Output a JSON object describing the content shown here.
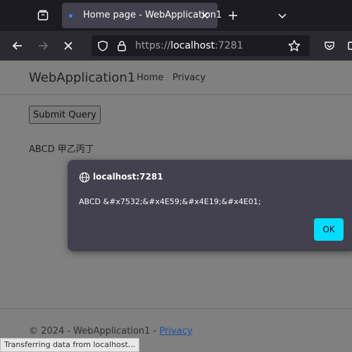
{
  "browser": {
    "tab": {
      "title": "Home page - WebApplication1"
    },
    "url": {
      "prefix": "https://",
      "host": "localhost",
      "port": ":7281"
    },
    "icons": [
      "tab-overview-icon",
      "new-tab-icon",
      "list-tabs-icon",
      "back-icon",
      "forward-icon",
      "stop-icon",
      "shield-icon",
      "lock-icon",
      "bookmark-star-icon",
      "pocket-icon",
      "extensions-icon"
    ],
    "status": "Transferring data from localhost..."
  },
  "site": {
    "brand": "WebApplication1",
    "nav": [
      "Home",
      "Privacy"
    ],
    "submit_label": "Submit Query",
    "output_text": "ABCD 甲乙丙丁",
    "footer": {
      "text": "© 2024 - WebApplication1 - ",
      "link": "Privacy"
    }
  },
  "dialog": {
    "origin": "localhost:7281",
    "message": "ABCD &#x7532;&#x4E59;&#x4E19;&#x4E01;",
    "ok_label": "OK"
  },
  "colors": {
    "accent": "#00ddff",
    "tab_indicator": "#2a8cff",
    "chrome_dark": "#1c1b22",
    "toolbar": "#2b2a33",
    "dialog_bg": "#42414d"
  }
}
